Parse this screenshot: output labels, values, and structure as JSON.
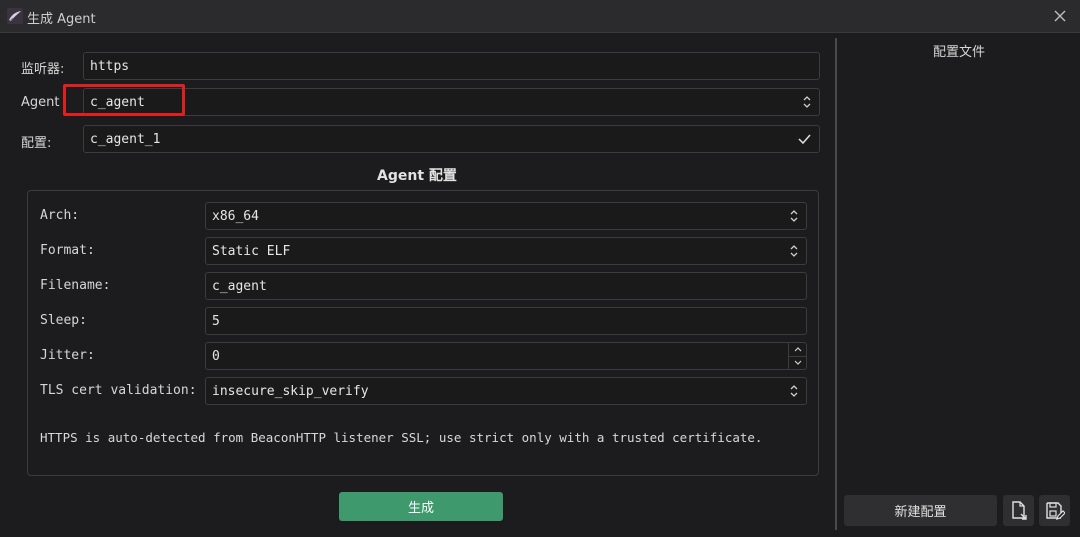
{
  "window": {
    "title": "生成 Agent"
  },
  "form": {
    "listener_label": "监听器:",
    "listener_value": "https",
    "agent_label": "Agent",
    "agent_value": "c_agent",
    "config_label": "配置:",
    "config_value": "c_agent_1"
  },
  "agent_config": {
    "title": "Agent 配置",
    "arch_label": "Arch:",
    "arch_value": "x86_64",
    "format_label": "Format:",
    "format_value": "Static ELF",
    "filename_label": "Filename:",
    "filename_value": "c_agent",
    "sleep_label": "Sleep:",
    "sleep_value": "5",
    "jitter_label": "Jitter:",
    "jitter_value": "0",
    "tls_label": "TLS cert validation:",
    "tls_value": "insecure_skip_verify",
    "note": "HTTPS is auto-detected from BeaconHTTP listener SSL; use strict only with a trusted certificate."
  },
  "actions": {
    "generate_label": "生成"
  },
  "right_panel": {
    "title": "配置文件",
    "new_config_label": "新建配置"
  },
  "colors": {
    "accent_green": "#3e9a6c",
    "highlight_red": "#e02020",
    "background": "#1c1c1e"
  }
}
